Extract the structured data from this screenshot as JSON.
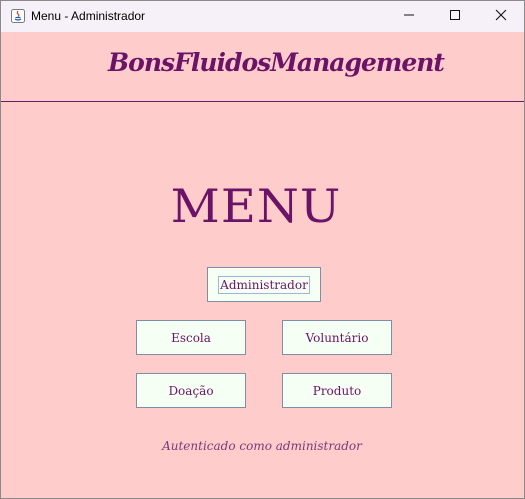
{
  "window": {
    "title": "Menu - Administrador",
    "app_icon": "java-icon",
    "controls": {
      "minimize_icon": "minimize-icon",
      "maximize_icon": "maximize-icon",
      "close_icon": "close-icon"
    }
  },
  "header": {
    "brand": "BonsFluidosManagement"
  },
  "main": {
    "title": "MENU",
    "buttons": {
      "administrador": "Administrador",
      "escola": "Escola",
      "voluntario": "Voluntário",
      "doacao": "Doação",
      "produto": "Produto"
    },
    "status": "Autenticado como administrador"
  },
  "colors": {
    "background": "#ffcccc",
    "accent": "#6b1366",
    "button_background": "#f6fff4",
    "button_border": "#7b8fa6"
  }
}
